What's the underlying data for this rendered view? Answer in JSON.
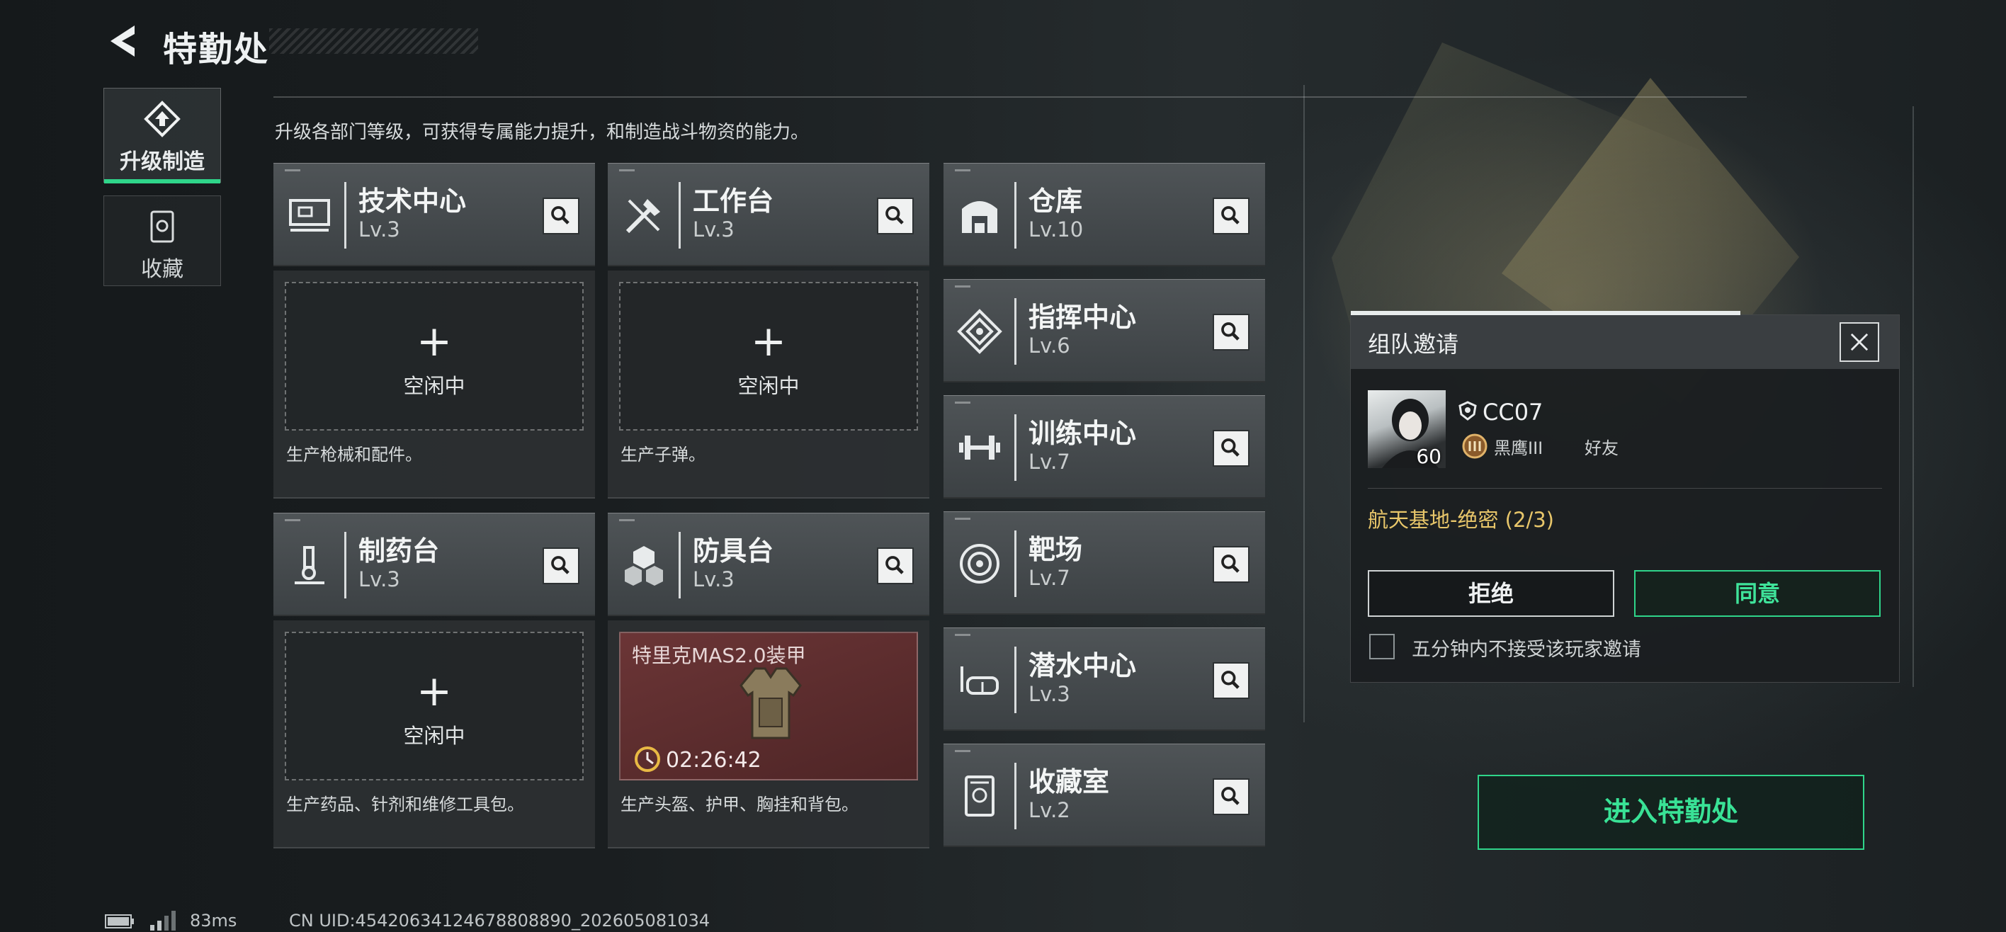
{
  "header": {
    "title": "特勤处"
  },
  "side_tabs": [
    {
      "label": "升级制造",
      "icon": "upgrade-icon",
      "active": true
    },
    {
      "label": "收藏",
      "icon": "collection-icon",
      "active": false
    }
  ],
  "subtitle": "升级各部门等级，可获得专属能力提升，和制造战斗物资的能力。",
  "stations": [
    {
      "name": "技术中心",
      "level": "Lv.3",
      "icon": "computer-icon",
      "status": "空闲中",
      "desc": "生产枪械和配件。"
    },
    {
      "name": "工作台",
      "level": "Lv.3",
      "icon": "tools-icon",
      "status": "空闲中",
      "desc": "生产子弹。"
    },
    {
      "name": "制药台",
      "level": "Lv.3",
      "icon": "microscope-icon",
      "status": "空闲中",
      "desc": "生产药品、针剂和维修工具包。"
    },
    {
      "name": "防具台",
      "level": "Lv.3",
      "icon": "cubes-icon",
      "desc": "生产头盔、护甲、胸挂和背包。",
      "crafting": {
        "item": "特里克MAS2.0装甲",
        "time": "02:26:42"
      }
    }
  ],
  "facilities": [
    {
      "name": "仓库",
      "level": "Lv.10",
      "icon": "warehouse-icon"
    },
    {
      "name": "指挥中心",
      "level": "Lv.6",
      "icon": "command-icon"
    },
    {
      "name": "训练中心",
      "level": "Lv.7",
      "icon": "dumbbell-icon"
    },
    {
      "name": "靶场",
      "level": "Lv.7",
      "icon": "target-icon"
    },
    {
      "name": "潜水中心",
      "level": "Lv.3",
      "icon": "goggles-icon"
    },
    {
      "name": "收藏室",
      "level": "Lv.2",
      "icon": "vault-icon"
    }
  ],
  "invite": {
    "title": "组队邀请",
    "player": {
      "name": "CC07",
      "level": "60",
      "rank": "黑鹰III",
      "relation": "好友"
    },
    "mission": "航天基地-绝密 (2/3)",
    "reject_label": "拒绝",
    "accept_label": "同意",
    "mute_label": "五分钟内不接受该玩家邀请"
  },
  "enter_label": "进入特勤处",
  "status_bar": {
    "ping": "83ms",
    "uid": "CN UID:45420634124678808890_202605081034"
  },
  "colors": {
    "accent": "#2fd58a",
    "mission": "#e8c66a",
    "crafting_bg": "#6b3536"
  }
}
